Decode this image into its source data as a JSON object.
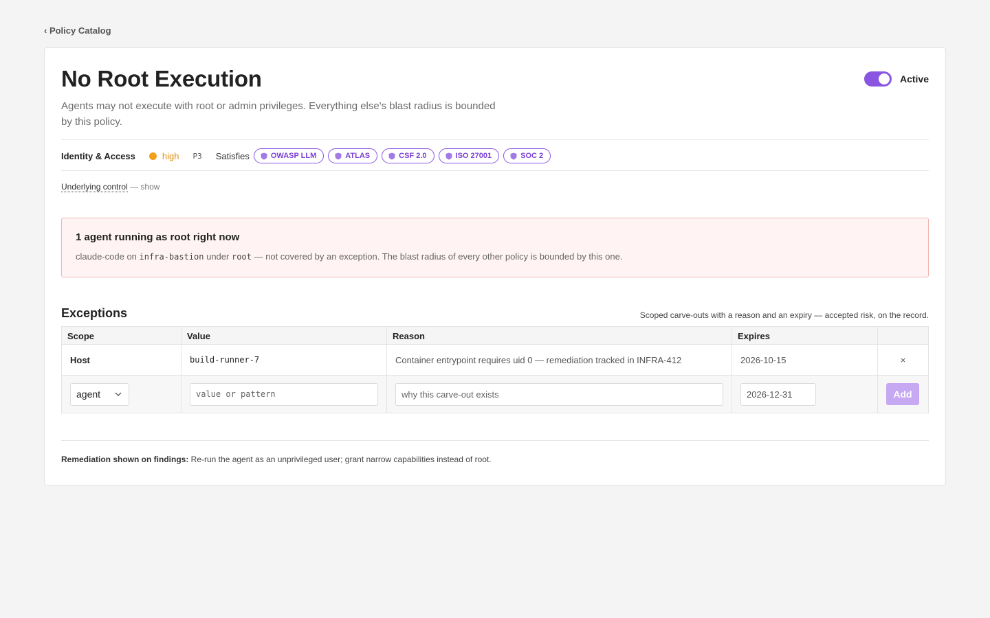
{
  "breadcrumb": {
    "back_label": "‹ Policy Catalog"
  },
  "policy": {
    "title": "No Root Execution",
    "description": "Agents may not execute with root or admin privileges. Everything else's blast radius is bounded by this policy.",
    "status_label": "Active",
    "active": true,
    "category": "Identity & Access",
    "severity": "high",
    "severity_color": "#f2a01a",
    "priority": "P3",
    "satisfies_label": "Satisfies",
    "frameworks": [
      "OWASP LLM",
      "ATLAS",
      "CSF 2.0",
      "ISO 27001",
      "SOC 2"
    ],
    "underlying_label": "Underlying control",
    "underlying_toggle": "— show"
  },
  "alert": {
    "title": "1 agent running as root right now",
    "agent": "claude-code",
    "text_on": "on",
    "host": "infra-bastion",
    "text_under": "under",
    "user": "root",
    "text_rest": "— not covered by an exception. The blast radius of every other policy is bounded by this one."
  },
  "exceptions": {
    "title": "Exceptions",
    "subtitle": "Scoped carve-outs with a reason and an expiry — accepted risk, on the record.",
    "columns": [
      "Scope",
      "Value",
      "Reason",
      "Expires"
    ],
    "rows": [
      {
        "scope": "Host",
        "value": "build-runner-7",
        "reason": "Container entrypoint requires uid 0 — remediation tracked in INFRA-412",
        "expires": "2026-10-15",
        "remove_icon": "×"
      }
    ],
    "new_row": {
      "scope_value": "agent",
      "value_placeholder": "value or pattern",
      "reason_placeholder": "why this carve-out exists",
      "expires_value": "2026-12-31",
      "add_label": "Add"
    }
  },
  "remediation": {
    "label": "Remediation shown on findings:",
    "text": "Re-run the agent as an unprivileged user; grant narrow capabilities instead of root."
  },
  "colors": {
    "accent": "#8a55e0",
    "severity_high": "#f2a01a",
    "alert_bg": "#fff4f3",
    "alert_border": "#f0b5b0"
  }
}
